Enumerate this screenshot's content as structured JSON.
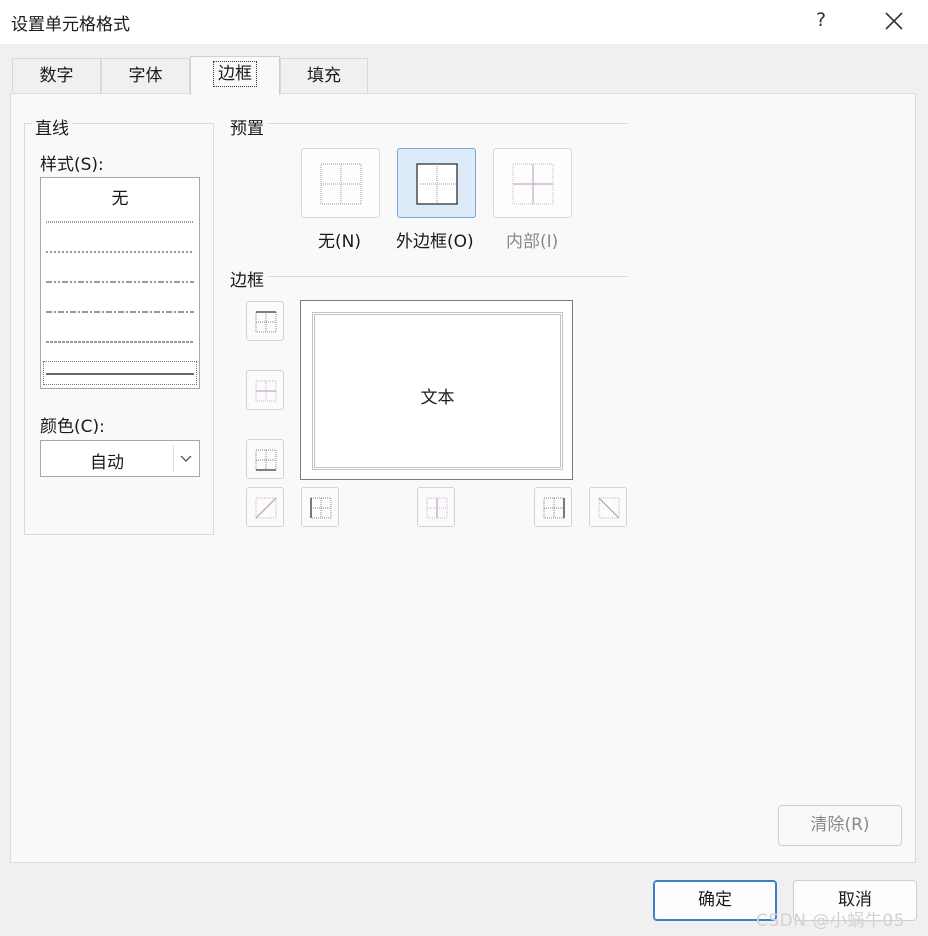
{
  "window": {
    "title": "设置单元格格式",
    "help_label": "?"
  },
  "tabs": [
    {
      "label": "数字"
    },
    {
      "label": "字体"
    },
    {
      "label": "边框"
    },
    {
      "label": "填充"
    }
  ],
  "active_tab": "边框",
  "line_group": {
    "title": "直线",
    "style_label": "样式(S):",
    "style_none": "无",
    "color_label": "颜色(C):",
    "color_value": "自动"
  },
  "presets": {
    "title": "预置",
    "items": [
      {
        "label": "无(N)",
        "enabled": true,
        "selected": false
      },
      {
        "label": "外边框(O)",
        "enabled": true,
        "selected": true
      },
      {
        "label": "内部(I)",
        "enabled": false,
        "selected": false
      }
    ]
  },
  "border": {
    "title": "边框",
    "preview_text": "文本"
  },
  "buttons": {
    "clear": "清除(R)",
    "ok": "确定",
    "cancel": "取消"
  },
  "watermark": "CSDN @小蜗牛05",
  "colors": {
    "accent": "#3c7fc6",
    "selected_bg": "#dcebf7",
    "disabled_text": "#8a8a8a"
  }
}
